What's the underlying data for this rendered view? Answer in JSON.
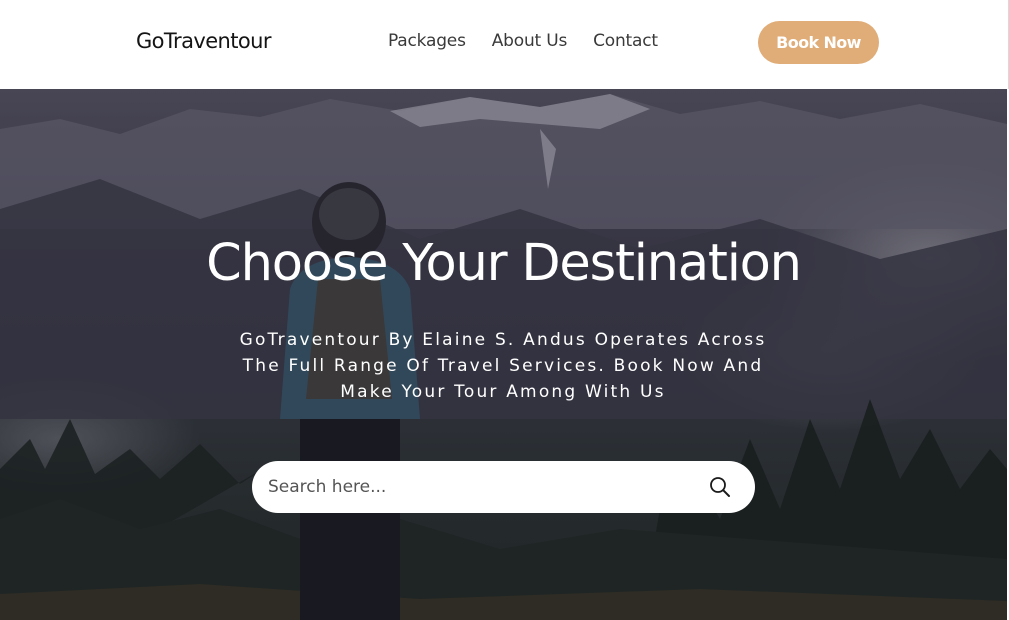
{
  "header": {
    "logo": "GoTraventour",
    "nav": [
      {
        "label": "Packages"
      },
      {
        "label": "About Us"
      },
      {
        "label": "Contact"
      }
    ],
    "cta_label": "Book Now",
    "cta_color": "#e0ac77"
  },
  "hero": {
    "title": "Choose Your Destination",
    "subtitle": "GoTraventour By Elaine S. Andus Operates Across The Full Range Of Travel Services. Book Now And Make Your Tour Among With Us",
    "search": {
      "placeholder": "Search here...",
      "icon": "search-icon"
    }
  }
}
